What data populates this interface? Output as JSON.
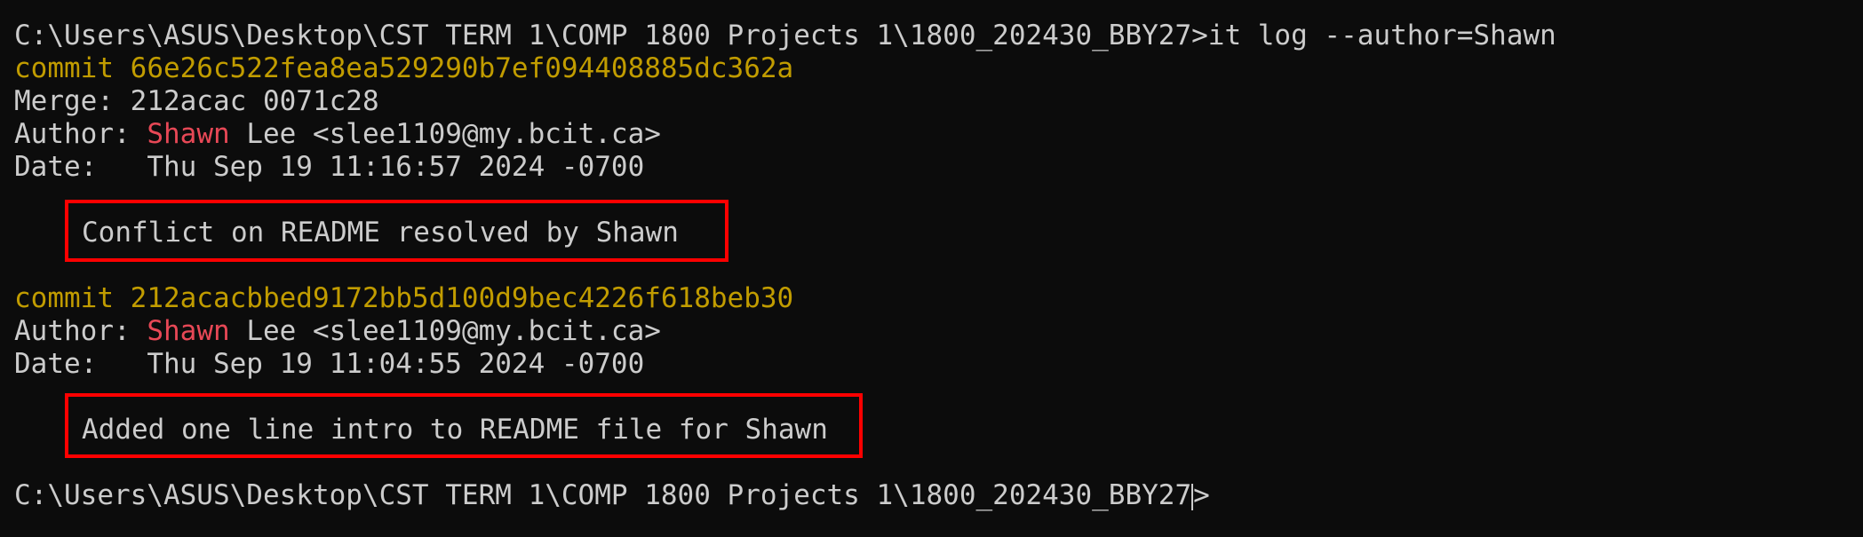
{
  "terminal": {
    "prompt_path": "C:\\Users\\ASUS\\Desktop\\CST TERM 1\\COMP 1800 Projects 1\\1800_202430_BBY27>",
    "command": "it log --author=Shawn",
    "commits": [
      {
        "commit_keyword": "commit",
        "hash": "66e26c522fea8ea529290b7ef094408885dc362a",
        "merge_label": "Merge:",
        "merge_value": "212acac 0071c28",
        "author_label": "Author:",
        "author_first": "Shawn",
        "author_rest": "Lee <slee1109@my.bcit.ca>",
        "date_label": "Date:",
        "date_value": "Thu Sep 19 11:16:57 2024 -0700",
        "message": "Conflict on README resolved by Shawn"
      },
      {
        "commit_keyword": "commit",
        "hash": "212acacbbed9172bb5d100d9bec4226f618beb30",
        "author_label": "Author:",
        "author_first": "Shawn",
        "author_rest": "Lee <slee1109@my.bcit.ca>",
        "date_label": "Date:",
        "date_value": "Thu Sep 19 11:04:55 2024 -0700",
        "message": "Added one line intro to README file for Shawn"
      }
    ],
    "final_prompt": "C:\\Users\\ASUS\\Desktop\\CST TERM 1\\COMP 1800 Projects 1\\1800_202430_BBY27>"
  },
  "colors": {
    "background": "#0c0c0c",
    "text": "#cccccc",
    "commit": "#c19c00",
    "author_name": "#e74856",
    "highlight_box": "#ff0000"
  }
}
